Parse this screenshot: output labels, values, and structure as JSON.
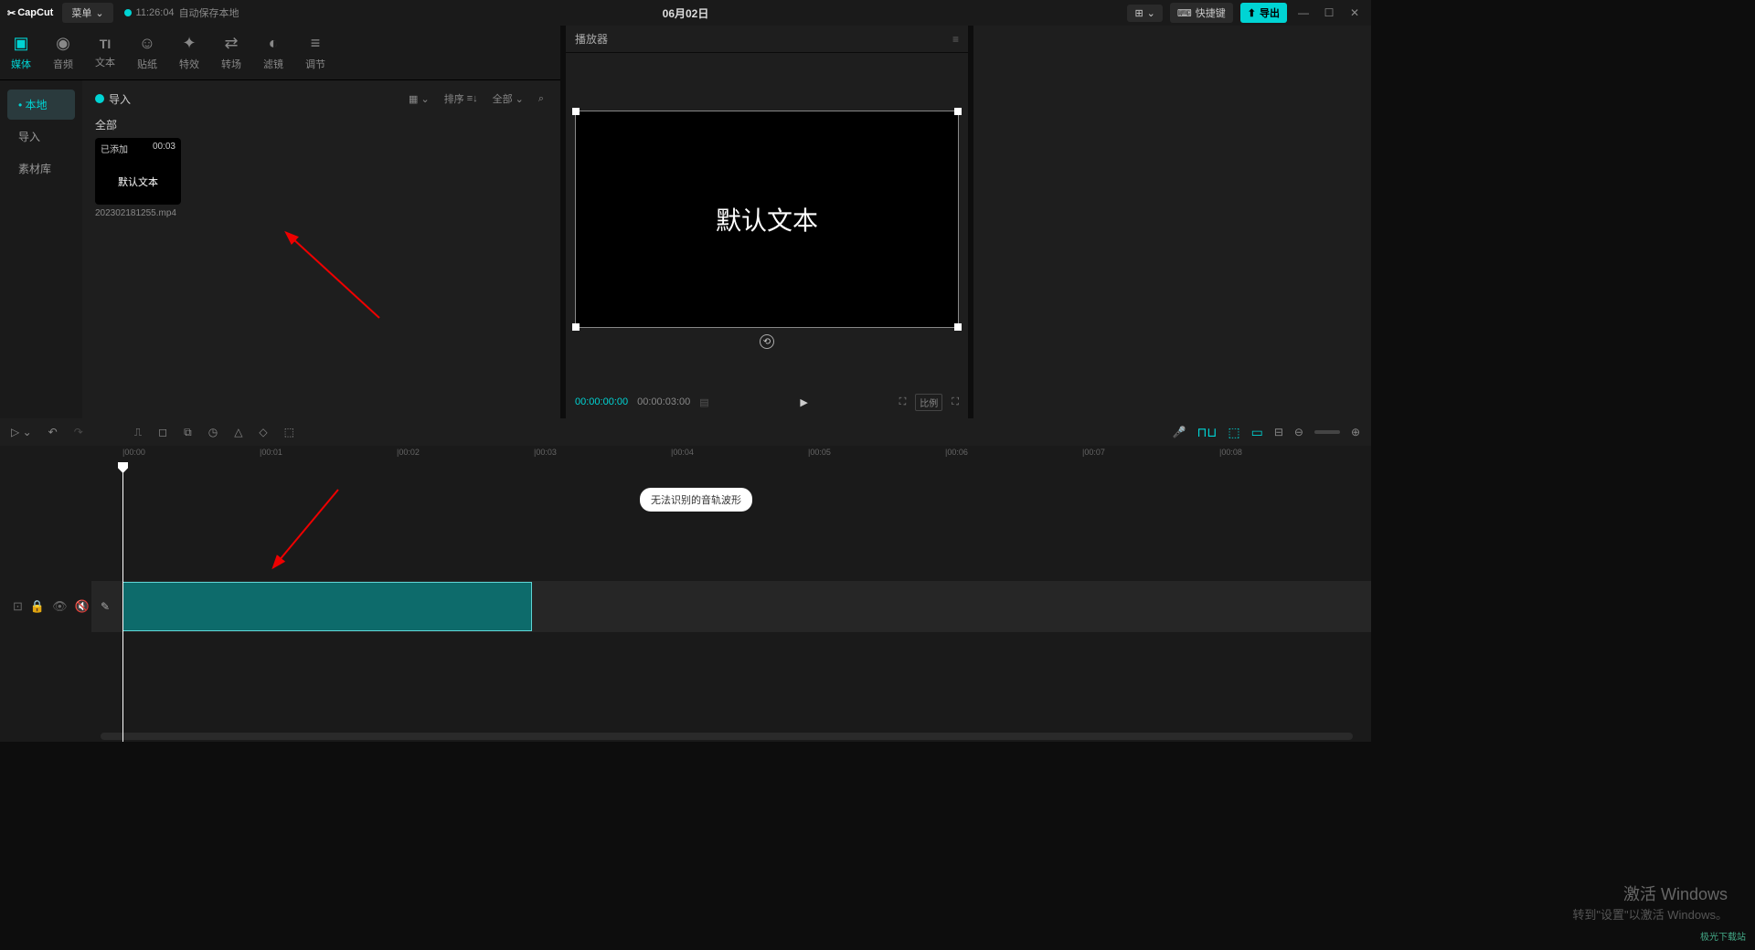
{
  "titlebar": {
    "logo": "CapCut",
    "menu": "菜单",
    "autosave_time": "11:26:04",
    "autosave_text": "自动保存本地",
    "project_title": "06月02日",
    "layout_btn": "⊞",
    "shortcut_btn": "快捷键",
    "export_btn": "导出"
  },
  "tabs": [
    {
      "label": "媒体",
      "icon": "▶"
    },
    {
      "label": "音频",
      "icon": "◉"
    },
    {
      "label": "文本",
      "icon": "TI"
    },
    {
      "label": "贴纸",
      "icon": "☺"
    },
    {
      "label": "特效",
      "icon": "✦"
    },
    {
      "label": "转场",
      "icon": "⇄"
    },
    {
      "label": "滤镜",
      "icon": "◐"
    },
    {
      "label": "调节",
      "icon": "≡"
    }
  ],
  "sidebar": [
    {
      "label": "本地",
      "active": true
    },
    {
      "label": "导入",
      "active": false
    },
    {
      "label": "素材库",
      "active": false
    }
  ],
  "media": {
    "import": "导入",
    "sort": "排序",
    "filter": "全部",
    "category": "全部",
    "thumb": {
      "tag": "已添加",
      "duration": "00:03",
      "text": "默认文本",
      "name": "202302181255.mp4"
    }
  },
  "player": {
    "title": "播放器",
    "canvas_text": "默认文本",
    "time_current": "00:00:00:00",
    "time_duration": "00:00:03:00",
    "ratio": "比例"
  },
  "timeline": {
    "tooltip": "无法识别的音轨波形",
    "marks": [
      "|00:00",
      "|00:01",
      "|00:02",
      "|00:03",
      "|00:04",
      "|00:05",
      "|00:06",
      "|00:07",
      "|00:08"
    ]
  },
  "watermark": {
    "line1": "激活 Windows",
    "line2": "转到\"设置\"以激活 Windows。",
    "logo": "极光下载站"
  }
}
